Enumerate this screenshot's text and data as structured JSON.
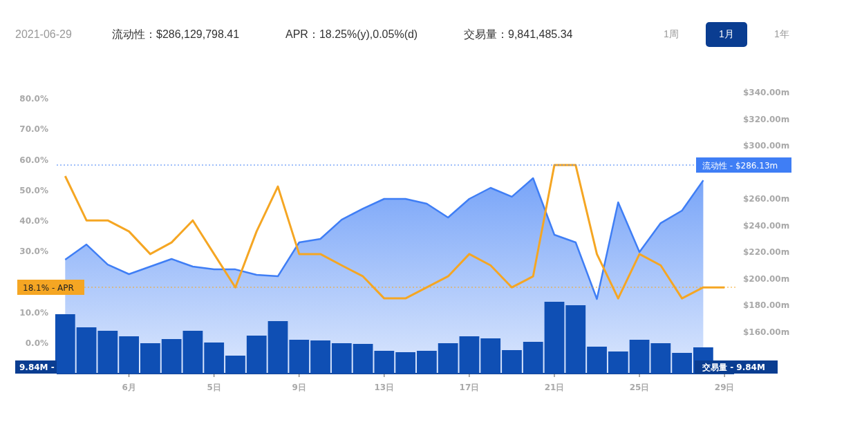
{
  "header": {
    "date": "2021-06-29",
    "stats": [
      "流动性：$286,129,798.41",
      "APR：18.25%(y),0.05%(d)",
      "交易量：9,841,485.34"
    ]
  },
  "range_buttons": [
    {
      "label": "1周",
      "selected": false
    },
    {
      "label": "1月",
      "selected": true
    },
    {
      "label": "1年",
      "selected": false
    }
  ],
  "chart": {
    "liquidity_chart": {
      "chart_data": {
        "type": "area",
        "categories": [
          null,
          null,
          null,
          "6月",
          null,
          null,
          null,
          "5日",
          null,
          null,
          null,
          "9日",
          null,
          null,
          null,
          "13日",
          null,
          null,
          null,
          "17日",
          null,
          null,
          null,
          "21日",
          null,
          null,
          null,
          "25日",
          null,
          null,
          null,
          "29日"
        ],
        "ylim": [
          128.6,
          340
        ],
        "yticks": [
          {
            "value": 340,
            "label": "$340.00m"
          },
          {
            "value": 320,
            "label": "$320.00m"
          },
          {
            "value": 300,
            "label": "$300.00m"
          },
          {
            "value": 260,
            "label": "$260.00m"
          },
          {
            "value": 240,
            "label": "$240.00m"
          },
          {
            "value": 220,
            "label": "$220.00m"
          },
          {
            "value": 200,
            "label": "$200.00m"
          },
          {
            "value": 180,
            "label": "$180.00m"
          },
          {
            "value": 160,
            "label": "$160.00m"
          }
        ],
        "series": [
          {
            "color": "#3f7ef5",
            "values": [
              214.3,
              225.7,
              210.6,
              203.4,
              209.1,
              214.8,
              209.1,
              207.0,
              207.0,
              202.9,
              201.8,
              227.3,
              229.9,
              244.4,
              252.7,
              260.0,
              260.0,
              256.4,
              246.0,
              260.0,
              268.3,
              261.6,
              275.6,
              233.0,
              227.3,
              184.7,
              257.4,
              220.0,
              241.8,
              251.2,
              274.0,
              null
            ]
          }
        ]
      }
    },
    "apr_chart": {
      "chart_data": {
        "type": "line",
        "ylim": [
          -9.9,
          80
        ],
        "yticks": [
          {
            "value": 80,
            "label": "80.0%"
          },
          {
            "value": 70,
            "label": "70.0%"
          },
          {
            "value": 60,
            "label": "60.0%"
          },
          {
            "value": 50,
            "label": "50.0%"
          },
          {
            "value": 40,
            "label": "40.0%"
          },
          {
            "value": 30,
            "label": "30.0%"
          },
          {
            "value": 10,
            "label": "10.0%"
          },
          {
            "value": 0,
            "label": "0.0%"
          }
        ],
        "series": [
          {
            "color": "#f5a623",
            "values": [
              54.7,
              40.2,
              40.2,
              36.6,
              29.2,
              33.0,
              40.2,
              29.2,
              18.3,
              36.6,
              51.3,
              29.2,
              29.2,
              25.5,
              21.9,
              14.7,
              14.7,
              18.3,
              21.9,
              29.2,
              25.5,
              18.3,
              21.9,
              58.3,
              58.3,
              29.2,
              14.7,
              29.2,
              25.5,
              14.7,
              18.3,
              18.3
            ]
          }
        ]
      }
    },
    "liquidity_label": "流动性 - $286.13m",
    "apr_label": "18.1% - APR",
    "volume_labels": [
      "9.84M -",
      "交易量 - 9.84M"
    ]
  }
}
